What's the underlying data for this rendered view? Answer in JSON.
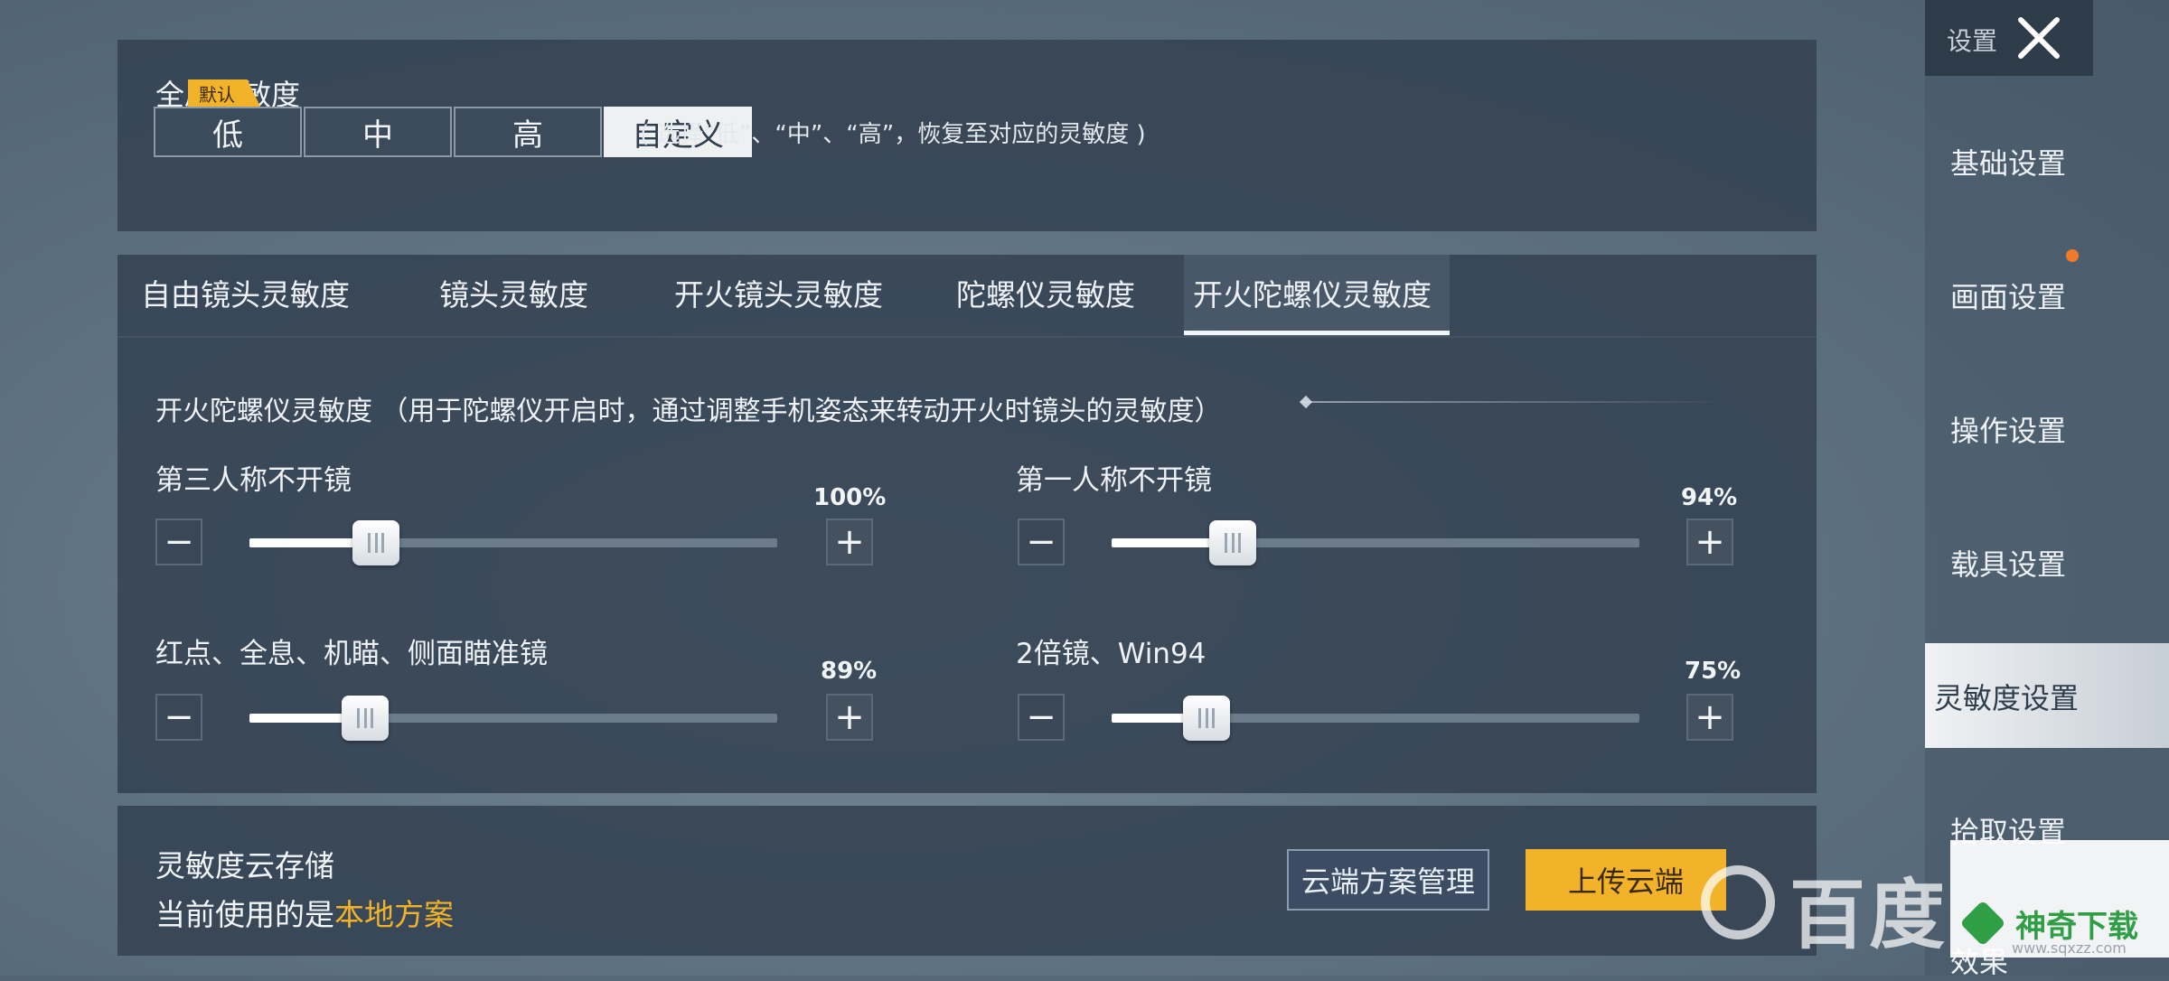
{
  "global": {
    "title": "全局灵敏度",
    "presets": [
      "低",
      "中",
      "高",
      "自定义"
    ],
    "active_preset_index": 3,
    "default_tag": "默认",
    "hint": "( 选择“低”、“中”、“高”，恢复至对应的灵敏度 )"
  },
  "tabs": {
    "items": [
      "自由镜头灵敏度",
      "镜头灵敏度",
      "开火镜头灵敏度",
      "陀螺仪灵敏度",
      "开火陀螺仪灵敏度"
    ],
    "active_index": 4
  },
  "section": {
    "description": "开火陀螺仪灵敏度 （用于陀螺仪开启时，通过调整手机姿态来转动开火时镜头的灵敏度）"
  },
  "sliders": [
    {
      "label": "第三人称不开镜",
      "value_text": "100%",
      "fill": 0.24
    },
    {
      "label": "第一人称不开镜",
      "value_text": "94%",
      "fill": 0.23
    },
    {
      "label": "红点、全息、机瞄、侧面瞄准镜",
      "value_text": "89%",
      "fill": 0.22
    },
    {
      "label": "2倍镜、Win94",
      "value_text": "75%",
      "fill": 0.18
    }
  ],
  "stepper": {
    "minus": "−",
    "plus": "+"
  },
  "cloud": {
    "title": "灵敏度云存储",
    "status_prefix": "当前使用的是",
    "status_value": "本地方案",
    "manage_button": "云端方案管理",
    "upload_button": "上传云端"
  },
  "sidebar": {
    "header": "设置",
    "items": [
      "基础设置",
      "画面设置",
      "操作设置",
      "载具设置",
      "灵敏度设置",
      "拾取设置",
      "效果"
    ],
    "active_index": 4
  },
  "watermark": {
    "baidu": "百度",
    "shenqi": "神奇下载",
    "url": "www.sqxzz.com"
  },
  "colors": {
    "accent": "#f2b32a",
    "notification": "#f07a2a"
  }
}
